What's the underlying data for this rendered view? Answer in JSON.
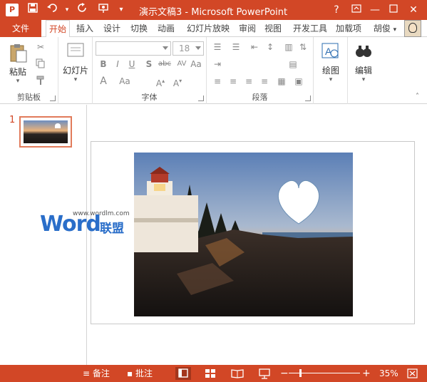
{
  "app": {
    "title": "演示文稿3 - Microsoft PowerPoint",
    "icon_letter": "P",
    "accent": "#d24726"
  },
  "quick_access": {
    "save_icon": "save-icon",
    "undo_icon": "undo-icon",
    "redo_icon": "redo-icon",
    "present_icon": "present-icon"
  },
  "window_controls": {
    "help": "?",
    "minimize": "—",
    "close": "✕"
  },
  "tabs": [
    {
      "label": "文件"
    },
    {
      "label": "开始"
    },
    {
      "label": "插入"
    },
    {
      "label": "设计"
    },
    {
      "label": "切换"
    },
    {
      "label": "动画"
    },
    {
      "label": "幻灯片放映"
    },
    {
      "label": "审阅"
    },
    {
      "label": "视图"
    },
    {
      "label": "开发工具"
    },
    {
      "label": "加载项"
    },
    {
      "label": "胡俊"
    }
  ],
  "ribbon": {
    "clipboard": {
      "paste_label": "粘贴",
      "group_label": "剪贴板"
    },
    "slides": {
      "slide_label": "幻灯片"
    },
    "font": {
      "size_value": "18",
      "group_label": "字体"
    },
    "paragraph": {
      "group_label": "段落"
    },
    "drawing": {
      "label": "绘图"
    },
    "editing": {
      "label": "编辑"
    }
  },
  "thumbnails": {
    "slide_number": "1"
  },
  "watermark": {
    "url": "www.wordlm.com",
    "word": "Word",
    "cn": "联盟"
  },
  "statusbar": {
    "notes_label": "备注",
    "comments_label": "批注",
    "zoom": "35%"
  }
}
